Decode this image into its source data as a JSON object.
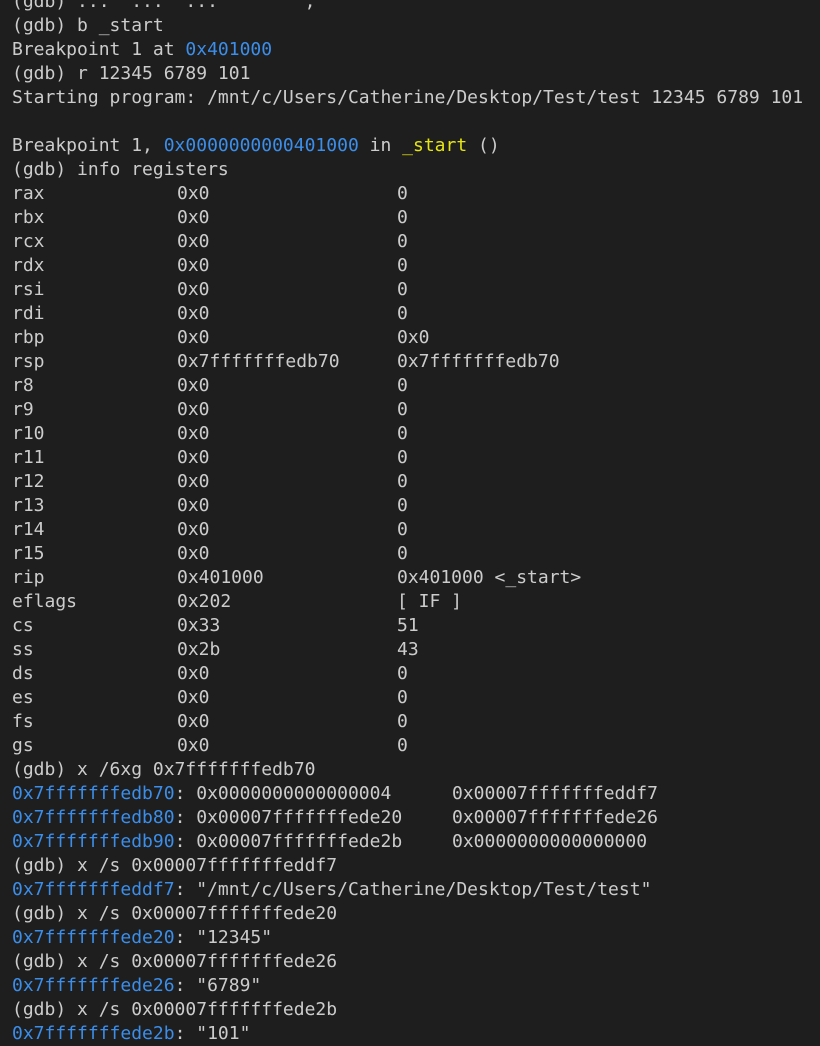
{
  "colors": {
    "background": "#1e1e1e",
    "foreground": "#cccccc",
    "address": "#3b8eea",
    "function": "#e5e510"
  },
  "top_cut_line": "(gdb) ...  ...  ...        ,",
  "cmd_break": "(gdb) b _start",
  "bp_set_prefix": "Breakpoint 1 at ",
  "bp_set_addr": "0x401000",
  "cmd_run": "(gdb) r 12345 6789 101",
  "starting_program": "Starting program: /mnt/c/Users/Catherine/Desktop/Test/test 12345 6789 101",
  "bp_hit_prefix": "Breakpoint 1, ",
  "bp_hit_addr": "0x0000000000401000",
  "bp_hit_in": " in ",
  "bp_hit_func": "_start",
  "bp_hit_suffix": " ()",
  "cmd_info_registers": "(gdb) info registers",
  "registers": [
    {
      "name": "rax",
      "hex": "0x0",
      "natural": "0"
    },
    {
      "name": "rbx",
      "hex": "0x0",
      "natural": "0"
    },
    {
      "name": "rcx",
      "hex": "0x0",
      "natural": "0"
    },
    {
      "name": "rdx",
      "hex": "0x0",
      "natural": "0"
    },
    {
      "name": "rsi",
      "hex": "0x0",
      "natural": "0"
    },
    {
      "name": "rdi",
      "hex": "0x0",
      "natural": "0"
    },
    {
      "name": "rbp",
      "hex": "0x0",
      "natural": "0x0"
    },
    {
      "name": "rsp",
      "hex": "0x7fffffffedb70",
      "natural": "0x7fffffffedb70"
    },
    {
      "name": "r8",
      "hex": "0x0",
      "natural": "0"
    },
    {
      "name": "r9",
      "hex": "0x0",
      "natural": "0"
    },
    {
      "name": "r10",
      "hex": "0x0",
      "natural": "0"
    },
    {
      "name": "r11",
      "hex": "0x0",
      "natural": "0"
    },
    {
      "name": "r12",
      "hex": "0x0",
      "natural": "0"
    },
    {
      "name": "r13",
      "hex": "0x0",
      "natural": "0"
    },
    {
      "name": "r14",
      "hex": "0x0",
      "natural": "0"
    },
    {
      "name": "r15",
      "hex": "0x0",
      "natural": "0"
    },
    {
      "name": "rip",
      "hex": "0x401000",
      "natural": "0x401000 <_start>"
    },
    {
      "name": "eflags",
      "hex": "0x202",
      "natural": "[ IF ]"
    },
    {
      "name": "cs",
      "hex": "0x33",
      "natural": "51"
    },
    {
      "name": "ss",
      "hex": "0x2b",
      "natural": "43"
    },
    {
      "name": "ds",
      "hex": "0x0",
      "natural": "0"
    },
    {
      "name": "es",
      "hex": "0x0",
      "natural": "0"
    },
    {
      "name": "fs",
      "hex": "0x0",
      "natural": "0"
    },
    {
      "name": "gs",
      "hex": "0x0",
      "natural": "0"
    }
  ],
  "cmd_examine_stack": "(gdb) x /6xg 0x7fffffffedb70",
  "stack_dump": [
    {
      "addr": "0x7fffffffedb70",
      "v1": "0x0000000000000004",
      "v2": "0x00007fffffffeddf7"
    },
    {
      "addr": "0x7fffffffedb80",
      "v1": "0x00007fffffffede20",
      "v2": "0x00007fffffffede26"
    },
    {
      "addr": "0x7fffffffedb90",
      "v1": "0x00007fffffffede2b",
      "v2": "0x0000000000000000"
    }
  ],
  "string_dumps": [
    {
      "cmd": "(gdb) x /s 0x00007fffffffeddf7",
      "addr": "0x7fffffffeddf7",
      "value": "\"/mnt/c/Users/Catherine/Desktop/Test/test\""
    },
    {
      "cmd": "(gdb) x /s 0x00007fffffffede20",
      "addr": "0x7fffffffede20",
      "value": "\"12345\""
    },
    {
      "cmd": "(gdb) x /s 0x00007fffffffede26",
      "addr": "0x7fffffffede26",
      "value": "\"6789\""
    },
    {
      "cmd": "(gdb) x /s 0x00007fffffffede2b",
      "addr": "0x7fffffffede2b",
      "value": "\"101\""
    }
  ]
}
